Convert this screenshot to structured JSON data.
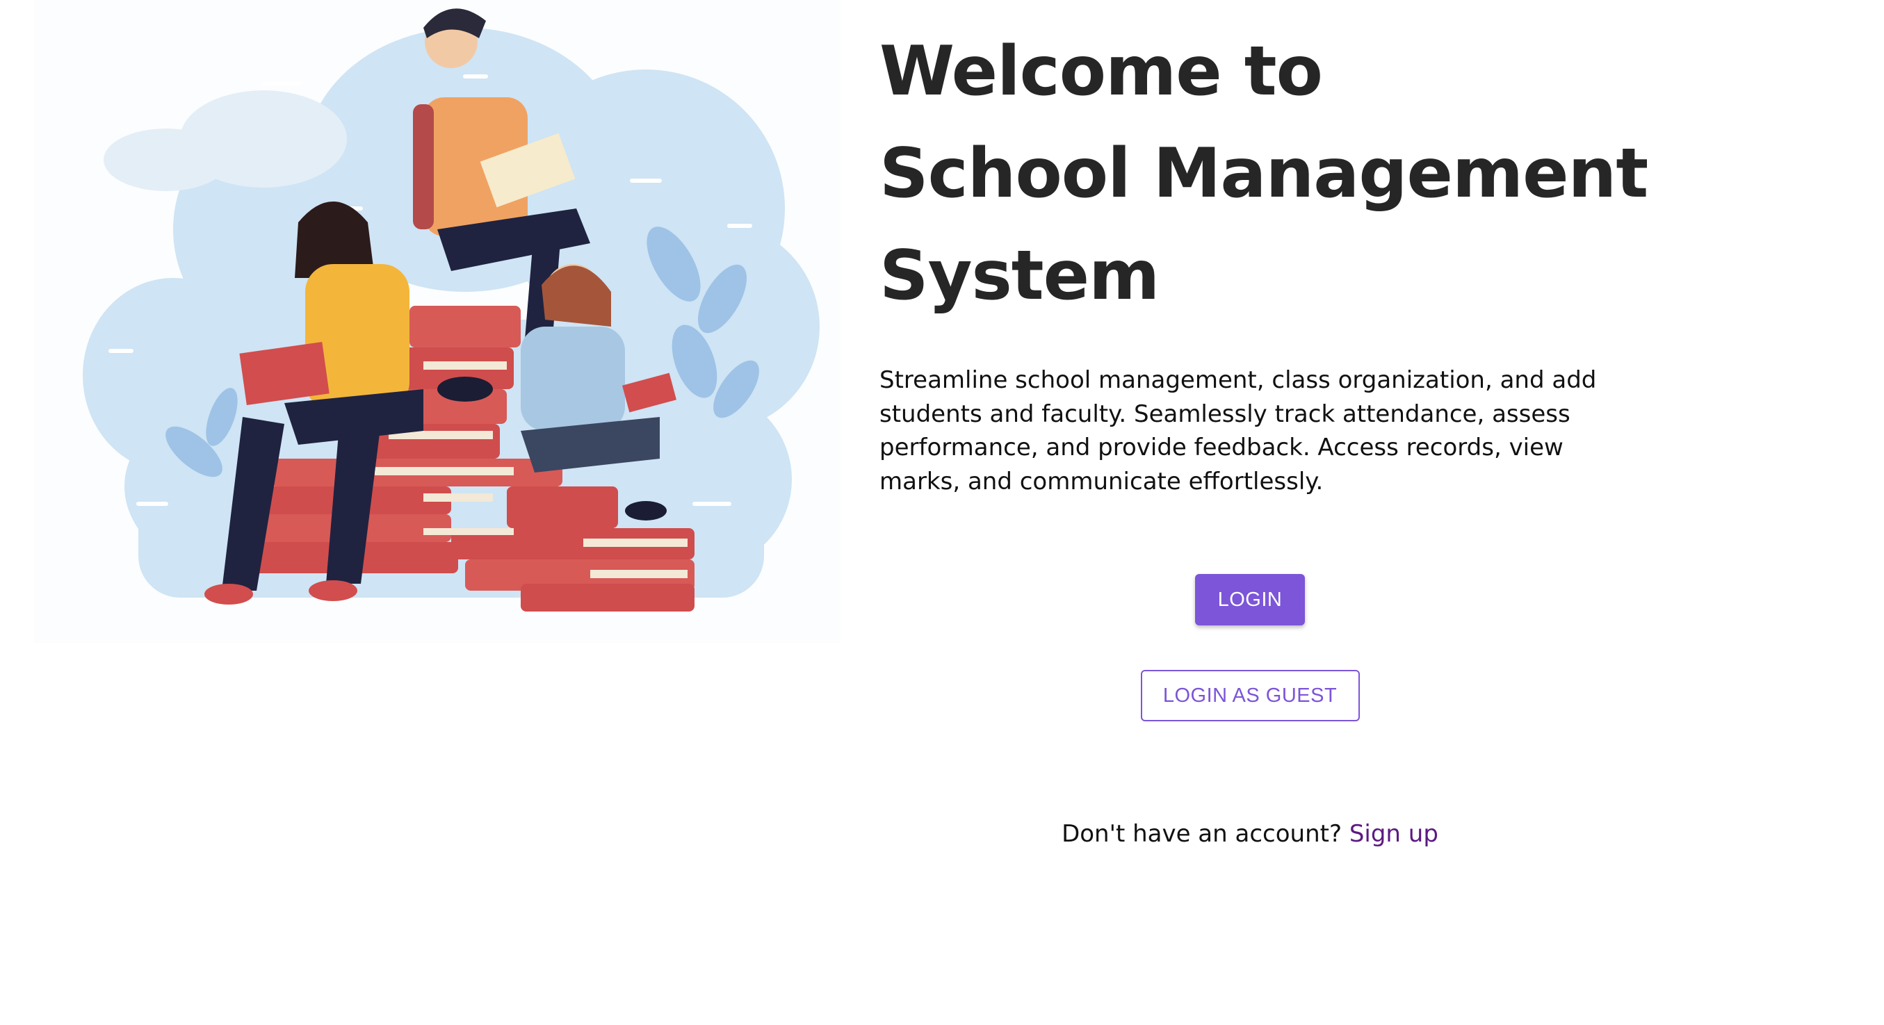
{
  "hero": {
    "title_line1": "Welcome to",
    "title_line2": "School Management",
    "title_line3": "System",
    "description": "Streamline school management, class organization, and add students and faculty. Seamlessly track attendance, assess performance, and provide feedback. Access records, view marks, and communicate effortlessly."
  },
  "actions": {
    "login_label": "LOGIN",
    "guest_label": "LOGIN AS GUEST"
  },
  "signup": {
    "prompt": "Don't have an account?",
    "link_label": "Sign up"
  },
  "colors": {
    "accent": "#7c55d8",
    "link": "#5c1a82",
    "title": "#262626"
  },
  "illustration": {
    "icon": "students-reading-books-illustration"
  }
}
